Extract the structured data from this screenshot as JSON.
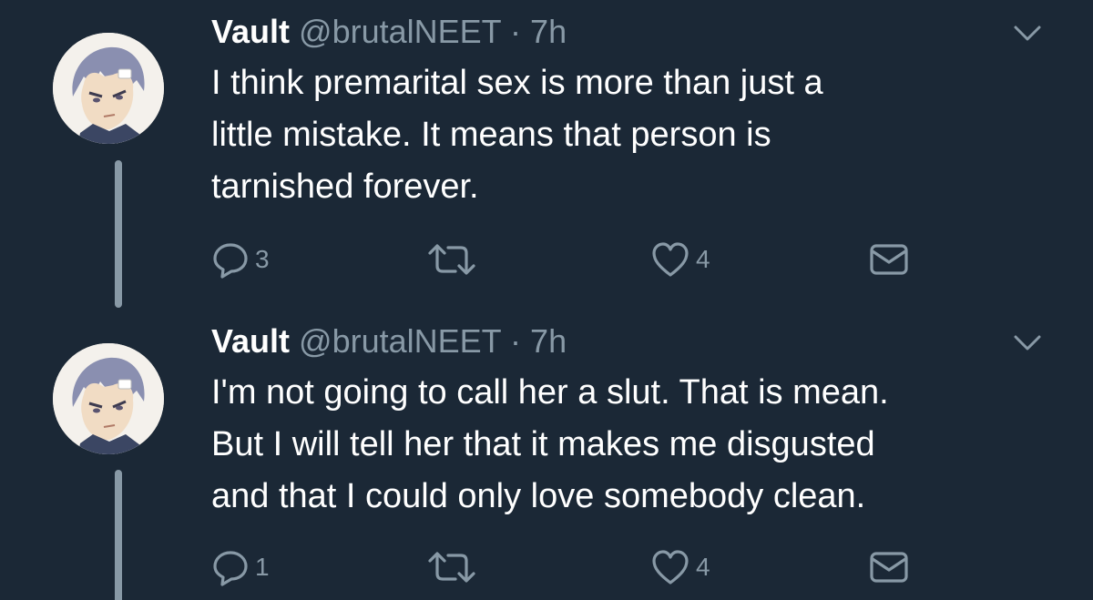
{
  "tweets": [
    {
      "display_name": "Vault",
      "handle": "@brutalNEET",
      "separator": "·",
      "time": "7h",
      "text": "I think premarital sex is more than just a\nlittle mistake. It means that person is\ntarnished forever.",
      "reply_count": "3",
      "like_count": "4"
    },
    {
      "display_name": "Vault",
      "handle": "@brutalNEET",
      "separator": "·",
      "time": "7h",
      "text": "I'm not going to call her a slut. That is mean.\nBut I will tell her that it makes me disgusted\nand that I could only love somebody clean.",
      "reply_count": "1",
      "like_count": "4"
    }
  ],
  "icons": {
    "reply": "reply-icon",
    "retweet": "retweet-icon",
    "like": "heart-icon",
    "dm": "envelope-icon",
    "more": "chevron-down-icon"
  },
  "colors": {
    "background": "#1b2836",
    "text": "#ffffff",
    "muted": "#8899a6"
  }
}
